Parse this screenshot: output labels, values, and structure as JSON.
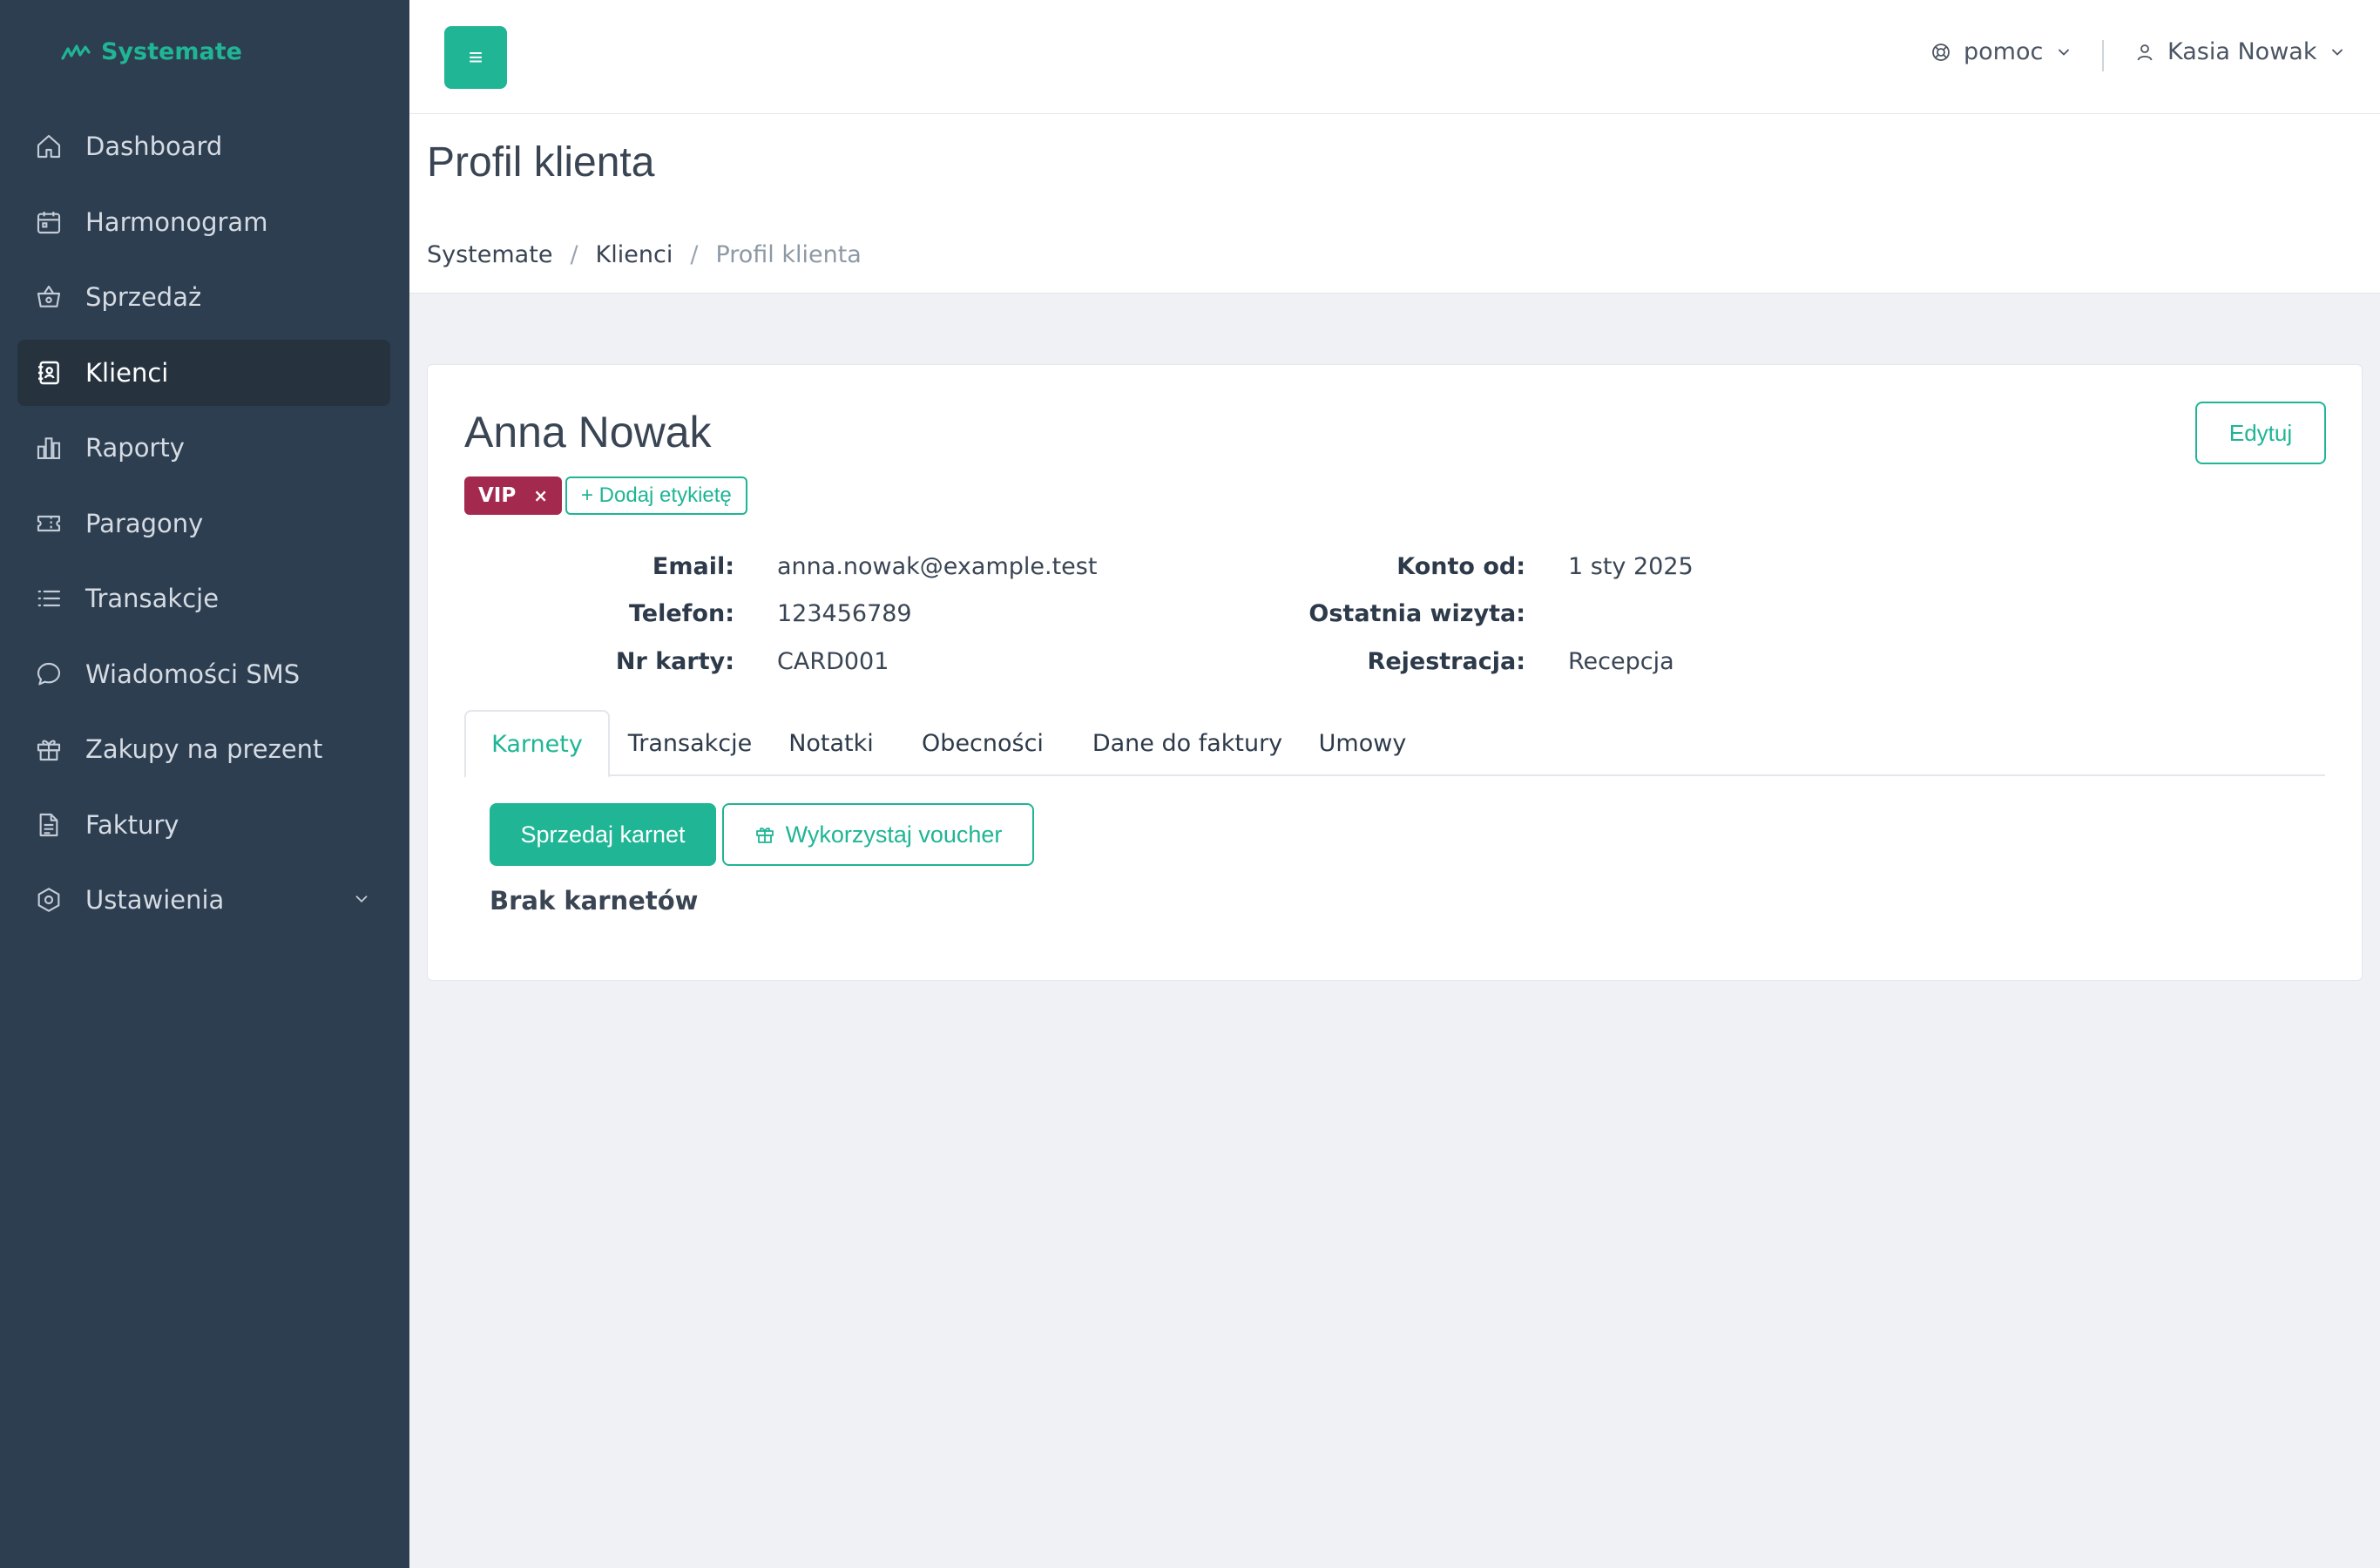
{
  "brand": {
    "name": "Systemate",
    "icon": "pulse-logo-icon",
    "color": "#1fb595"
  },
  "sidebar": {
    "items": [
      {
        "label": "Dashboard",
        "icon": "home-icon"
      },
      {
        "label": "Harmonogram",
        "icon": "calendar-icon"
      },
      {
        "label": "Sprzedaż",
        "icon": "basket-icon"
      },
      {
        "label": "Klienci",
        "icon": "contacts-book-icon",
        "active": true
      },
      {
        "label": "Raporty",
        "icon": "bar-chart-icon"
      },
      {
        "label": "Paragony",
        "icon": "ticket-icon"
      },
      {
        "label": "Transakcje",
        "icon": "list-icon"
      },
      {
        "label": "Wiadomości SMS",
        "icon": "chat-bubble-icon"
      },
      {
        "label": "Zakupy na prezent",
        "icon": "gift-icon"
      },
      {
        "label": "Faktury",
        "icon": "document-icon"
      },
      {
        "label": "Ustawienia",
        "icon": "settings-hex-icon",
        "has_submenu": true
      }
    ]
  },
  "topbar": {
    "menu_icon": "≡",
    "help_label": "pomoc",
    "user_name": "Kasia Nowak"
  },
  "page": {
    "title": "Profil klienta",
    "breadcrumb": [
      "Systemate",
      "Klienci",
      "Profil klienta"
    ]
  },
  "client": {
    "name": "Anna Nowak",
    "edit_label": "Edytuj",
    "tags": [
      {
        "label": "VIP",
        "color": "#a3294e",
        "remove": "×"
      }
    ],
    "add_tag_label": "+ Dodaj etykietę",
    "info_left": [
      {
        "label": "Email:",
        "value": "anna.nowak@example.test"
      },
      {
        "label": "Telefon:",
        "value": "123456789"
      },
      {
        "label": "Nr karty:",
        "value": "CARD001"
      }
    ],
    "info_right": [
      {
        "label": "Konto od:",
        "value": "1 sty 2025"
      },
      {
        "label": "Ostatnia wizyta:",
        "value": ""
      },
      {
        "label": "Rejestracja:",
        "value": "Recepcja"
      }
    ]
  },
  "tabs": [
    "Karnety",
    "Transakcje",
    "Notatki",
    "Obecności",
    "Dane do faktury",
    "Umowy"
  ],
  "active_tab": "Karnety",
  "karnety": {
    "sell_label": "Sprzedaj karnet",
    "voucher_label": "Wykorzystaj voucher",
    "empty_message": "Brak karnetów"
  },
  "colors": {
    "accent": "#1fb595",
    "sidebar": "#2d3e50",
    "vip": "#a3294e"
  }
}
